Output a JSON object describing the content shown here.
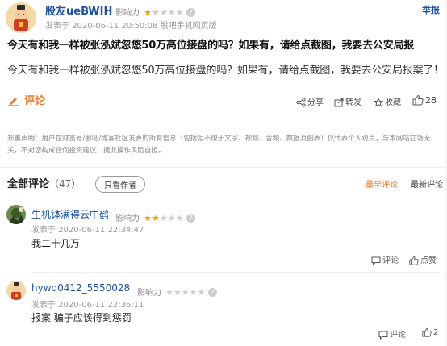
{
  "post": {
    "author": "股友ueBWIH",
    "influence_label": "影响力",
    "influence_stars": 1,
    "posted_at": "发表于 2020-06-11 20:50:08 股吧手机网页版",
    "report_label": "举报",
    "title": "今天有和我一样被张泓斌忽悠50万高位接盘的吗？如果有，请给点截图，我要去公安局报",
    "body": "今天有和我一样被张泓斌忽悠50万高位接盘的吗？如果有，请给点截图，我要去公安局报案了！",
    "comment_label": "评论",
    "actions": {
      "share": "分享",
      "forward": "转发",
      "favorite": "收藏",
      "like_count": "28"
    },
    "disclaimer": "郑重声明：用户在财富号/股吧/博客社区发表的所有信息（包括但不限于文字、视频、音频、数据及图表）仅代表个人观点，与本网站立场无关，不对您构成任何投资建议，据此操作风险自担。"
  },
  "comments_section": {
    "title": "全部评论",
    "count": "（47）",
    "only_author": "只看作者",
    "sort_hot": "最早评论",
    "sort_new": "最新评论"
  },
  "comments": [
    {
      "author": "生机钵满得云中鹤",
      "influence_label": "影响力",
      "influence_stars": 2,
      "posted_at": "发表于 2020-06-11 22:34:47",
      "text": "我二十几万",
      "reply_label": "评论",
      "like_label": "点赞"
    },
    {
      "author": "hywq0412_5550028",
      "influence_label": "影响力",
      "influence_stars": 0,
      "posted_at": "发表于 2020-06-11 22:36:11",
      "text": "报案 骗子应该得到惩罚",
      "reply_label": "评论",
      "like_count": "2"
    }
  ]
}
